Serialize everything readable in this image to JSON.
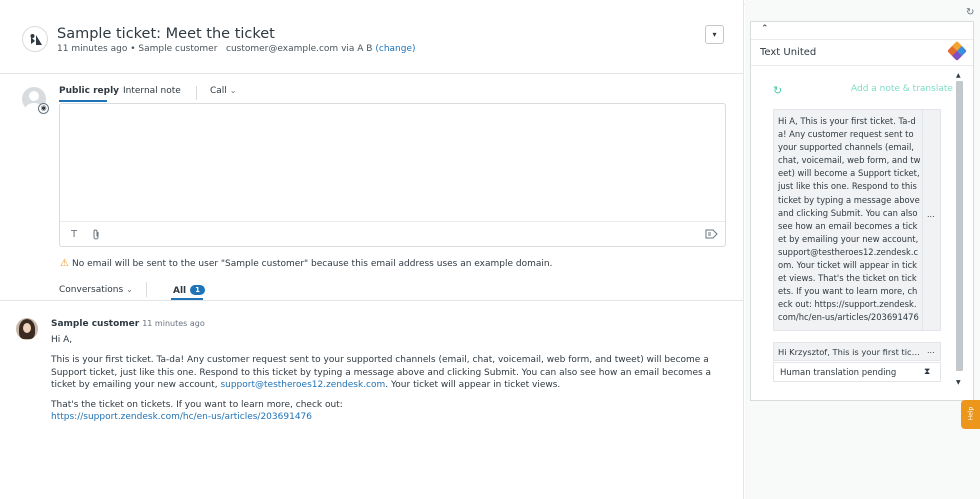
{
  "ticket": {
    "title": "Sample ticket: Meet the ticket",
    "time_ago": "11 minutes ago",
    "separator": "•",
    "requester": "Sample customer",
    "email": "customer@example.com",
    "via": "via A B",
    "change_link": "(change)",
    "dropdown_icon": "chevron-down-icon"
  },
  "composer": {
    "tabs": [
      {
        "label": "Public reply",
        "active": true
      },
      {
        "label": "Internal note",
        "active": false
      },
      {
        "label": "Call",
        "active": false
      }
    ],
    "toolbar": {
      "text_format_icon": "T",
      "attach_icon": "paperclip-icon",
      "macro_icon": "macro-icon"
    },
    "warning_text": "No email will be sent to the user \"Sample customer\" because this email address uses an example domain."
  },
  "filter": {
    "conversations_label": "Conversations",
    "all_label": "All",
    "all_count": "1"
  },
  "message": {
    "author": "Sample customer",
    "time": "11 minutes ago",
    "greeting": "Hi A,",
    "para1": "This is your first ticket. Ta-da! Any customer request sent to your supported channels (email, chat, voicemail, web form, and tweet) will become a Support ticket, just like this one. Respond to this ticket by typing a message above and clicking Submit. You can also see how an email becomes a ticket by emailing your new account,",
    "para1_link": "support@testheroes12.zendesk.com",
    "para1_tail": ". Your ticket will appear in ticket views.",
    "para2": "That's the ticket on tickets. If you want to learn more, check out:",
    "para2_link": "https://support.zendesk.com/hc/en-us/articles/203691476"
  },
  "app": {
    "title": "Text United",
    "add_note": "Add a note & translate",
    "translation_text": "Hi A, This is your first ticket. Ta-da! Any customer request sent to your supported channels (email, chat, voicemail, web form, and tweet) will become a Support ticket, just like this one. Respond to this ticket by typing a message above and clicking Submit. You can also see how an email becomes a ticket by emailing your new account, support@testheroes12.zendesk.com. Your ticket will appear in ticket views. That's the ticket on tickets. If you want to learn more, check out: https://support.zendesk.com/hc/en-us/articles/203691476",
    "row2_text": "Hi Krzysztof, This is your first ticke...",
    "more_label": "...",
    "pending_label": "Human translation pending",
    "help_label": "Help"
  },
  "colors": {
    "link": "#1f73b7",
    "accent_teal": "#4cc9a6",
    "warning": "#ed961c",
    "help_tab": "#ed961c"
  }
}
